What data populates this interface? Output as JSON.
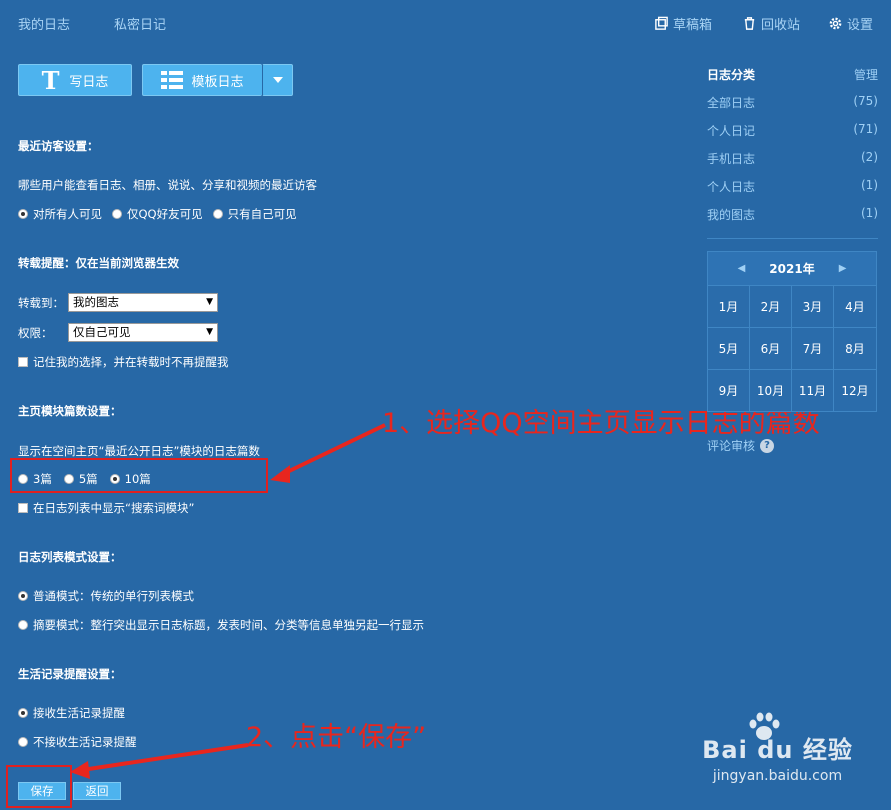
{
  "nav": {
    "my_diary": "我的日志",
    "private_diary": "私密日记",
    "drafts": "草稿箱",
    "recycle": "回收站",
    "settings": "设置"
  },
  "toolbar": {
    "write": "写日志",
    "template": "模板日志"
  },
  "visitor": {
    "title": "最近访客设置：",
    "desc": "哪些用户能查看日志、相册、说说、分享和视频的最近访客",
    "options": [
      "对所有人可见",
      "仅QQ好友可见",
      "只有自己可见"
    ],
    "selected": 0
  },
  "repost": {
    "title": "转载提醒：仅在当前浏览器生效",
    "to_label": "转载到：",
    "to_value": "我的图志",
    "perm_label": "权限：",
    "perm_value": "仅自己可见",
    "remember": "记住我的选择，并在转载时不再提醒我"
  },
  "homepage": {
    "title": "主页模块篇数设置：",
    "desc": "显示在空间主页“最近公开日志”模块的日志篇数",
    "options": [
      "3篇",
      "5篇",
      "10篇"
    ],
    "selected": 2,
    "search_module": "在日志列表中显示“搜索词模块”"
  },
  "list_mode": {
    "title": "日志列表模式设置：",
    "options": [
      "普通模式：传统的单行列表模式",
      "摘要模式：整行突出显示日志标题，发表时间、分类等信息单独另起一行显示"
    ],
    "selected": 0
  },
  "life": {
    "title": "生活记录提醒设置：",
    "options": [
      "接收生活记录提醒",
      "不接收生活记录提醒"
    ],
    "selected": 0
  },
  "actions": {
    "save": "保存",
    "back": "返回"
  },
  "sidebar": {
    "title": "日志分类",
    "manage": "管理",
    "categories": [
      {
        "name": "全部日志",
        "count": "(75)"
      },
      {
        "name": "个人日记",
        "count": "(71)"
      },
      {
        "name": "手机日志",
        "count": "(2)"
      },
      {
        "name": "个人日志",
        "count": "(1)"
      },
      {
        "name": "我的图志",
        "count": "(1)"
      }
    ],
    "year": "2021年",
    "months": [
      "1月",
      "2月",
      "3月",
      "4月",
      "5月",
      "6月",
      "7月",
      "8月",
      "9月",
      "10月",
      "11月",
      "12月"
    ],
    "review": "评论审核"
  },
  "annotations": {
    "step1": "1、选择QQ空间主页显示日志的篇数",
    "step2": "2、点击“保存”"
  },
  "watermark": {
    "brand": "Bai du 经验",
    "url": "jingyan.baidu.com"
  },
  "colors": {
    "background": "#2768a6",
    "button": "#4db3ee",
    "annotation": "#e8261e",
    "link": "#9fd0f5"
  }
}
